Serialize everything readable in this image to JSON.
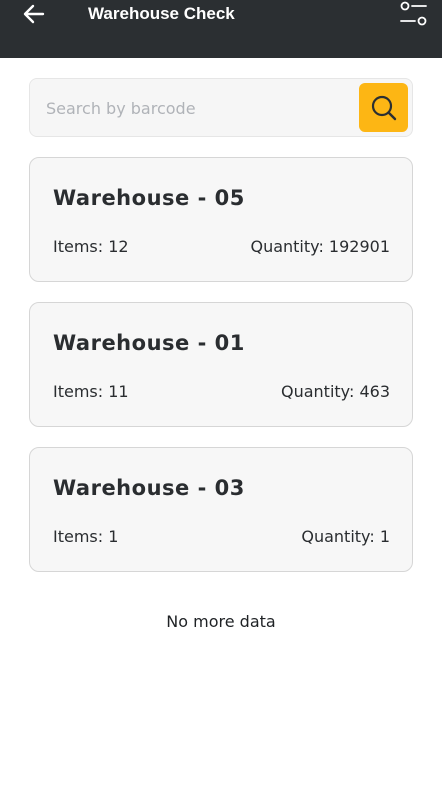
{
  "header": {
    "title": "Warehouse Check",
    "back_icon": "arrow-left-icon",
    "filter_icon": "filter-sliders-icon",
    "background_color": "#2b2f32"
  },
  "search": {
    "placeholder": "Search by barcode",
    "value": "",
    "button_icon": "search-icon",
    "button_color": "#fdb614"
  },
  "warehouses": [
    {
      "title": "Warehouse - 05",
      "items": "Items: 12",
      "quantity": "Quantity: 192901"
    },
    {
      "title": "Warehouse - 01",
      "items": "Items: 11",
      "quantity": "Quantity: 463"
    },
    {
      "title": "Warehouse - 03",
      "items": "Items: 1",
      "quantity": "Quantity: 1"
    }
  ],
  "footer": {
    "no_more": "No more data"
  }
}
